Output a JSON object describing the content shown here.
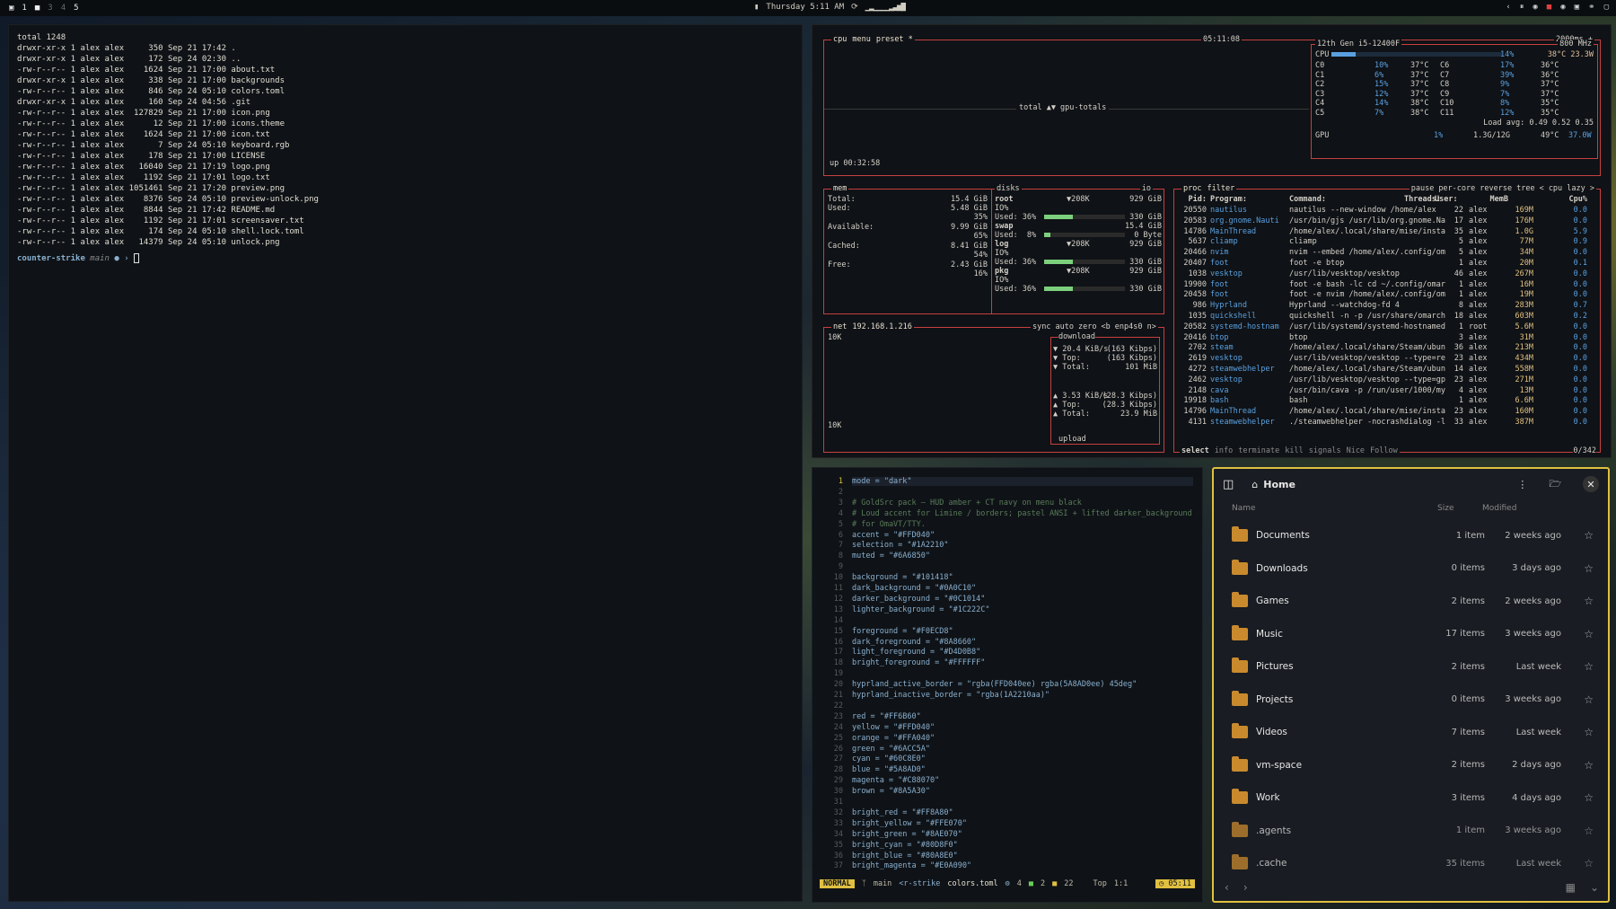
{
  "topbar": {
    "workspaces": [
      "1",
      "2",
      "3",
      "4",
      "5"
    ],
    "datetime": "Thursday 5:11 AM"
  },
  "terminal": {
    "lines": [
      "total 1248",
      "drwxr-xr-x 1 alex alex     350 Sep 21 17:42 .",
      "drwxr-xr-x 1 alex alex     172 Sep 24 02:30 ..",
      "-rw-r--r-- 1 alex alex    1624 Sep 21 17:00 about.txt",
      "drwxr-xr-x 1 alex alex     338 Sep 21 17:00 backgrounds",
      "-rw-r--r-- 1 alex alex     846 Sep 24 05:10 colors.toml",
      "drwxr-xr-x 1 alex alex     160 Sep 24 04:56 .git",
      "-rw-r--r-- 1 alex alex  127829 Sep 21 17:00 icon.png",
      "-rw-r--r-- 1 alex alex      12 Sep 21 17:00 icons.theme",
      "-rw-r--r-- 1 alex alex    1624 Sep 21 17:00 icon.txt",
      "-rw-r--r-- 1 alex alex       7 Sep 24 05:10 keyboard.rgb",
      "-rw-r--r-- 1 alex alex     178 Sep 21 17:00 LICENSE",
      "-rw-r--r-- 1 alex alex   16040 Sep 21 17:19 logo.png",
      "-rw-r--r-- 1 alex alex    1192 Sep 21 17:01 logo.txt",
      "-rw-r--r-- 1 alex alex 1051461 Sep 21 17:20 preview.png",
      "-rw-r--r-- 1 alex alex    8376 Sep 24 05:10 preview-unlock.png",
      "-rw-r--r-- 1 alex alex    8844 Sep 21 17:42 README.md",
      "-rw-r--r-- 1 alex alex    1192 Sep 21 17:01 screensaver.txt",
      "-rw-r--r-- 1 alex alex     174 Sep 24 05:10 shell.lock.toml",
      "-rw-r--r-- 1 alex alex   14379 Sep 24 05:10 unlock.png"
    ],
    "prompt_host": "counter-strike",
    "prompt_branch": "main",
    "prompt_tail": " ● › "
  },
  "btop": {
    "cpu_hdr": "cpu",
    "menu": "menu",
    "preset": "preset *",
    "clock": "05:11:08",
    "interval": "2000ms +",
    "gpu_totals": "total ▲▼ gpu-totals",
    "uptime": "up 00:32:58",
    "cpu_model": "12th Gen i5-12400F",
    "freq": "800 MHz",
    "cpu_total": "CPU",
    "cpu_pct": "14%",
    "cpu_temp": "38°C 23.3W",
    "cores": [
      [
        "C0",
        "10%",
        "37°C",
        "C6",
        "17%",
        "36°C"
      ],
      [
        "C1",
        "6%",
        "37°C",
        "C7",
        "39%",
        "36°C"
      ],
      [
        "C2",
        "15%",
        "37°C",
        "C8",
        "9%",
        "37°C"
      ],
      [
        "C3",
        "12%",
        "37°C",
        "C9",
        "7%",
        "37°C"
      ],
      [
        "C4",
        "14%",
        "38°C",
        "C10",
        "8%",
        "35°C"
      ],
      [
        "C5",
        "7%",
        "38°C",
        "C11",
        "12%",
        "35°C"
      ]
    ],
    "load_avg": "Load avg: 0.49 0.52 0.35",
    "gpu": {
      "label": "GPU",
      "pct": "1%",
      "mem": "1.3G/12G",
      "temp": "49°C",
      "power": "37.0W"
    },
    "mem": {
      "title": "mem",
      "rows": [
        [
          "Total:",
          "15.4 GiB"
        ],
        [
          "Used:",
          "5.48 GiB"
        ],
        [
          "",
          "35%"
        ],
        [
          "Available:",
          "9.99 GiB"
        ],
        [
          "",
          "65%"
        ],
        [
          "Cached:",
          "8.41 GiB"
        ],
        [
          "",
          "54%"
        ],
        [
          "Free:",
          "2.43 GiB"
        ],
        [
          "",
          "16%"
        ]
      ]
    },
    "disks": {
      "title": "disks",
      "io": "io",
      "items": [
        {
          "name": "root",
          "io": "▼208K",
          "size": "929 GiB",
          "io_lbl": "IO%",
          "used": "Used: 36%",
          "used_size": "330 GiB",
          "used_frac": 0.36
        },
        {
          "name": "swap",
          "size": "15.4 GiB",
          "used": "Used:  8%",
          "used_size": "0 Byte",
          "used_frac": 0.08
        },
        {
          "name": "log",
          "io": "▼208K",
          "size": "929 GiB",
          "io_lbl": "IO%",
          "used": "Used: 36%",
          "used_size": "330 GiB",
          "used_frac": 0.36
        },
        {
          "name": "pkg",
          "io": "▼208K",
          "size": "929 GiB",
          "io_lbl": "IO%",
          "used": "Used: 36%",
          "used_size": "330 GiB",
          "used_frac": 0.36
        }
      ]
    },
    "net": {
      "title": "net",
      "ip": "192.168.1.216",
      "sync": "sync",
      "auto": "auto",
      "zero": "zero",
      "iface": "<b enp4s0 n>",
      "scale_top": "10K",
      "scale_bot": "10K",
      "download": "download",
      "dl": [
        [
          "▼ 20.4 KiB/s",
          "(163 Kibps)"
        ],
        [
          "▼ Top:",
          "(163 Kibps)"
        ],
        [
          "▼ Total:",
          "101 MiB"
        ]
      ],
      "ul": [
        [
          "▲ 3.53 KiB/s",
          "(28.3 Kibps)"
        ],
        [
          "▲ Top:",
          "(28.3 Kibps)"
        ],
        [
          "▲ Total:",
          "23.9 MiB"
        ]
      ],
      "upload": "upload"
    },
    "proc": {
      "title": "proc",
      "filter": "filter",
      "opts": [
        "pause",
        "per-core",
        "reverse",
        "tree",
        "< cpu lazy >"
      ],
      "headers": [
        "Pid:",
        "Program:",
        "Command:",
        "Threads:",
        "User:",
        "MemB",
        "Cpu%"
      ],
      "rows": [
        [
          "20550",
          "nautilus",
          "nautilus --new-window /home/alex",
          "22",
          "alex",
          "169M",
          "0.0"
        ],
        [
          "20583",
          "org.gnome.Nauti",
          "/usr/bin/gjs /usr/lib/org.gnome.Na",
          "17",
          "alex",
          "176M",
          "0.0"
        ],
        [
          "14786",
          "MainThread",
          "/home/alex/.local/share/mise/insta",
          "35",
          "alex",
          "1.0G",
          "5.9"
        ],
        [
          "5637",
          "cliamp",
          "cliamp",
          "5",
          "alex",
          "77M",
          "0.9"
        ],
        [
          "20466",
          "nvim",
          "nvim --embed /home/alex/.config/om",
          "5",
          "alex",
          "34M",
          "0.0"
        ],
        [
          "20407",
          "foot",
          "foot -e btop",
          "1",
          "alex",
          "20M",
          "0.1"
        ],
        [
          "1038",
          "vesktop",
          "/usr/lib/vesktop/vesktop",
          "46",
          "alex",
          "267M",
          "0.0"
        ],
        [
          "19900",
          "foot",
          "foot -e bash -lc cd ~/.config/omar",
          "1",
          "alex",
          "16M",
          "0.0"
        ],
        [
          "20458",
          "foot",
          "foot -e nvim /home/alex/.config/om",
          "1",
          "alex",
          "19M",
          "0.0"
        ],
        [
          "986",
          "Hyprland",
          "Hyprland --watchdog-fd 4",
          "8",
          "alex",
          "283M",
          "0.7"
        ],
        [
          "1035",
          "quickshell",
          "quickshell -n -p /usr/share/omarch",
          "18",
          "alex",
          "603M",
          "0.2"
        ],
        [
          "20582",
          "systemd-hostnam",
          "/usr/lib/systemd/systemd-hostnamed",
          "1",
          "root",
          "5.6M",
          "0.0"
        ],
        [
          "20416",
          "btop",
          "btop",
          "3",
          "alex",
          "31M",
          "0.0"
        ],
        [
          "2702",
          "steam",
          "/home/alex/.local/share/Steam/ubun",
          "36",
          "alex",
          "213M",
          "0.0"
        ],
        [
          "2619",
          "vesktop",
          "/usr/lib/vesktop/vesktop --type=re",
          "23",
          "alex",
          "434M",
          "0.0"
        ],
        [
          "4272",
          "steamwebhelper",
          "/home/alex/.local/share/Steam/ubun",
          "14",
          "alex",
          "558M",
          "0.0"
        ],
        [
          "2462",
          "vesktop",
          "/usr/lib/vesktop/vesktop --type=gp",
          "23",
          "alex",
          "271M",
          "0.0"
        ],
        [
          "2148",
          "cava",
          "/usr/bin/cava -p /run/user/1000/my",
          "4",
          "alex",
          "13M",
          "0.0"
        ],
        [
          "19918",
          "bash",
          "bash",
          "1",
          "alex",
          "6.6M",
          "0.0"
        ],
        [
          "14796",
          "MainThread",
          "/home/alex/.local/share/mise/insta",
          "23",
          "alex",
          "160M",
          "0.0"
        ],
        [
          "4131",
          "steamwebhelper",
          "./steamwebhelper -nocrashdialog -l",
          "33",
          "alex",
          "387M",
          "0.0"
        ]
      ],
      "footer": [
        "select",
        "info",
        "terminate",
        "kill",
        "signals",
        "Nice",
        "Follow"
      ],
      "count": "0/342"
    }
  },
  "nvim": {
    "lines": [
      [
        "1",
        "mode = \"dark\""
      ],
      [
        "2",
        ""
      ],
      [
        "3",
        "# GoldSrc pack — HUD amber + CT navy on menu black"
      ],
      [
        "4",
        "# Loud accent for Limine / borders; pastel ANSI + lifted darker_background"
      ],
      [
        "5",
        "# for OmaVT/TTY."
      ],
      [
        "6",
        "accent = \"#FFD040\""
      ],
      [
        "7",
        "selection = \"#1A2210\""
      ],
      [
        "8",
        "muted = \"#6A6850\""
      ],
      [
        "9",
        ""
      ],
      [
        "10",
        "background = \"#101418\""
      ],
      [
        "11",
        "dark_background = \"#0A0C10\""
      ],
      [
        "12",
        "darker_background = \"#0C1014\""
      ],
      [
        "13",
        "lighter_background = \"#1C222C\""
      ],
      [
        "14",
        ""
      ],
      [
        "15",
        "foreground = \"#F0ECD8\""
      ],
      [
        "16",
        "dark_foreground = \"#8A8660\""
      ],
      [
        "17",
        "light_foreground = \"#D4D0B8\""
      ],
      [
        "18",
        "bright_foreground = \"#FFFFFF\""
      ],
      [
        "19",
        ""
      ],
      [
        "20",
        "hyprland_active_border = \"rgba(FFD040ee) rgba(5A8AD0ee) 45deg\""
      ],
      [
        "21",
        "hyprland_inactive_border = \"rgba(1A2210aa)\""
      ],
      [
        "22",
        ""
      ],
      [
        "23",
        "red = \"#FF6B60\""
      ],
      [
        "24",
        "yellow = \"#FFD040\""
      ],
      [
        "25",
        "orange = \"#FFA040\""
      ],
      [
        "26",
        "green = \"#6ACC5A\""
      ],
      [
        "27",
        "cyan = \"#60C8E0\""
      ],
      [
        "28",
        "blue = \"#5A8AD0\""
      ],
      [
        "29",
        "magenta = \"#C88070\""
      ],
      [
        "30",
        "brown = \"#8A5A30\""
      ],
      [
        "31",
        ""
      ],
      [
        "32",
        "bright_red = \"#FF8A80\""
      ],
      [
        "33",
        "bright_yellow = \"#FFE070\""
      ],
      [
        "34",
        "bright_green = \"#8AE070\""
      ],
      [
        "35",
        "bright_cyan = \"#80D8F0\""
      ],
      [
        "36",
        "bright_blue = \"#80A8E0\""
      ],
      [
        "37",
        "bright_magenta = \"#E0A090\""
      ]
    ],
    "status": {
      "mode": "NORMAL",
      "branch": "main",
      "path": "<r-strike",
      "file": "colors.toml",
      "diag": "4",
      "add": "2",
      "mod": "22",
      "pos": "Top",
      "rc": "1:1",
      "time": "05:11"
    }
  },
  "files": {
    "title": "Home",
    "col_name": "Name",
    "col_size": "Size",
    "col_modified": "Modified",
    "rows": [
      [
        "Documents",
        "1 item",
        "2 weeks ago"
      ],
      [
        "Downloads",
        "0 items",
        "3 days ago"
      ],
      [
        "Games",
        "2 items",
        "2 weeks ago"
      ],
      [
        "Music",
        "17 items",
        "3 weeks ago"
      ],
      [
        "Pictures",
        "2 items",
        "Last week"
      ],
      [
        "Projects",
        "0 items",
        "3 weeks ago"
      ],
      [
        "Videos",
        "7 items",
        "Last week"
      ],
      [
        "vm-space",
        "2 items",
        "2 days ago"
      ],
      [
        "Work",
        "3 items",
        "4 days ago"
      ],
      [
        ".agents",
        "1 item",
        "3 weeks ago"
      ],
      [
        ".cache",
        "35 items",
        "Last week"
      ]
    ]
  },
  "colors": {
    "accent": "#FFD040",
    "btop_border": "#C74040",
    "bar_green": "#7CCF7C",
    "folder": "#C98A2E",
    "cpu_blue": "#5AA0E0"
  }
}
